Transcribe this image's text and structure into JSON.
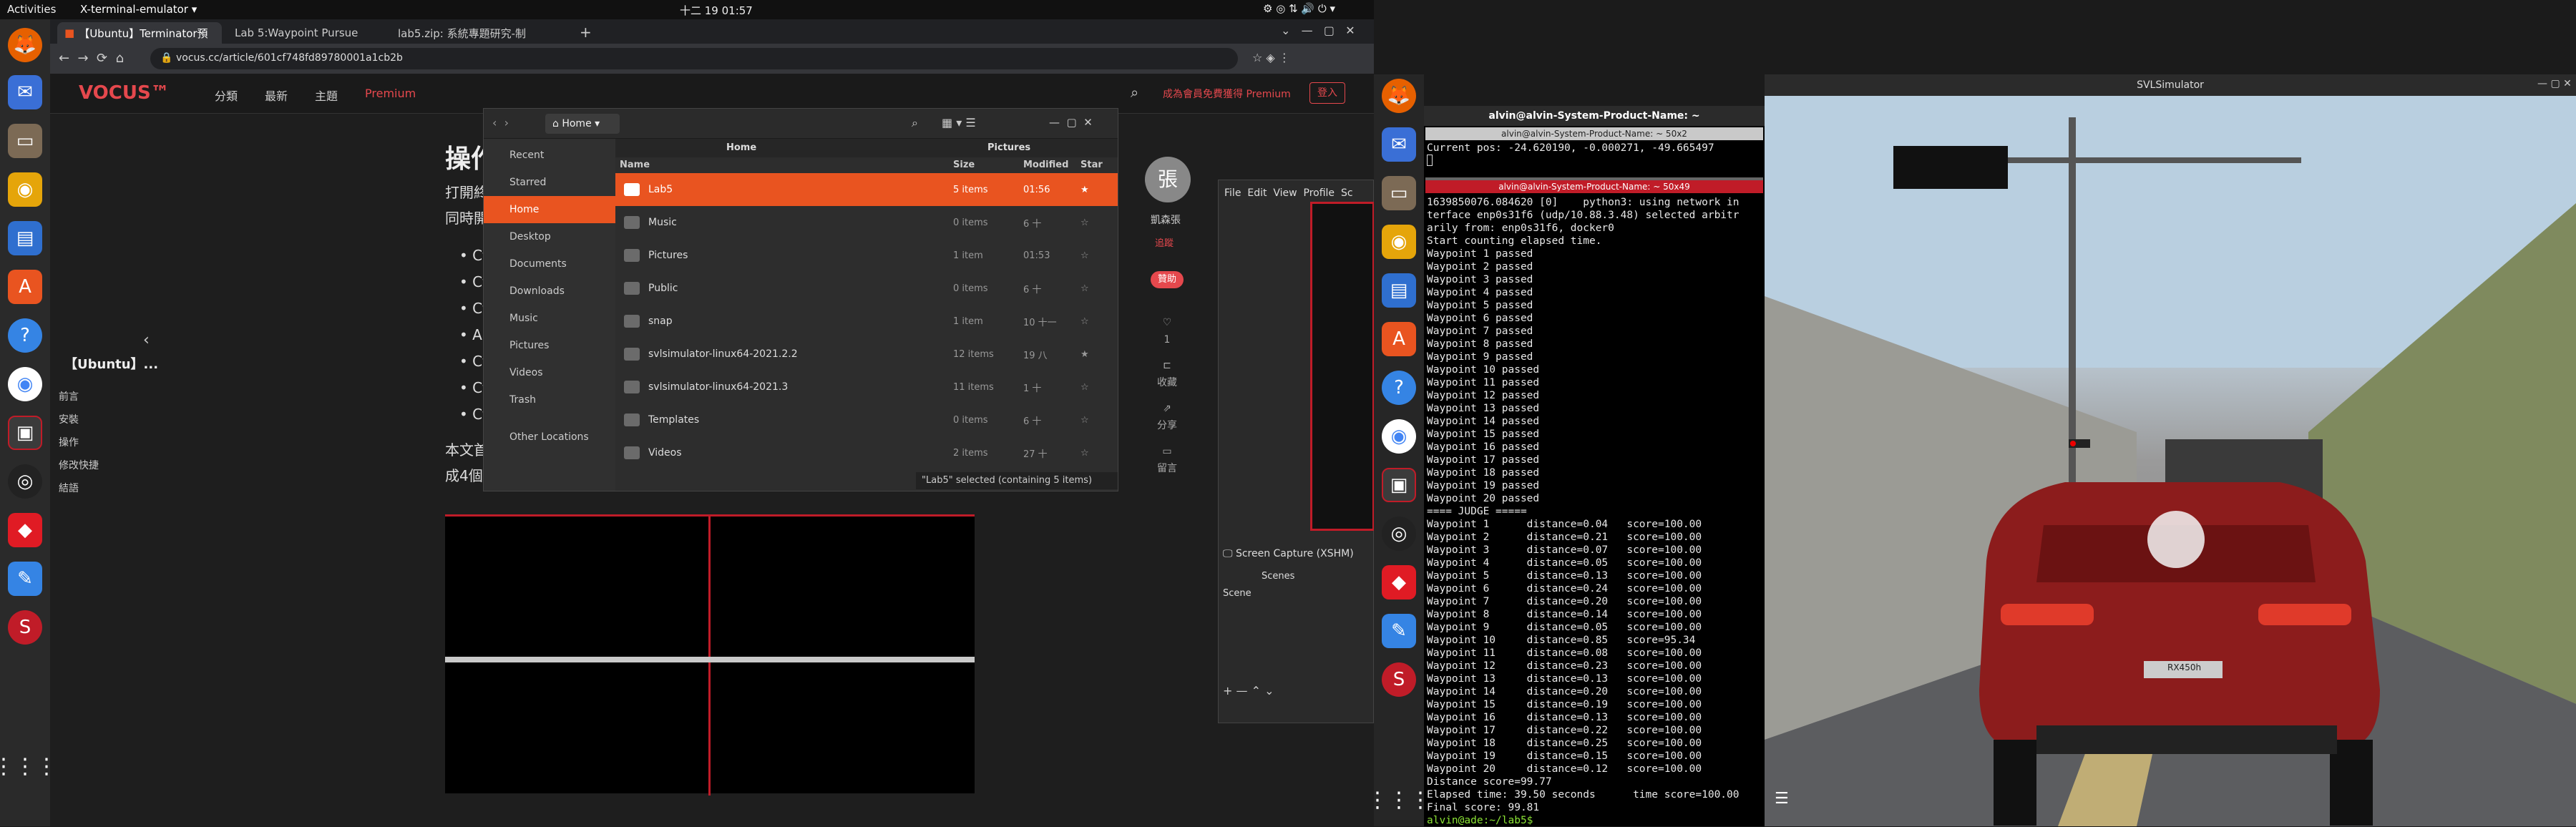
{
  "topbar": {
    "activities": "Activities",
    "app": "X-terminal-emulator ▾",
    "clock": "十二 19  01:57"
  },
  "browser": {
    "tabs": [
      "【Ubuntu】Terminator預",
      "Lab 5:Waypoint Pursue",
      "lab5.zip: 系統專題研究-制"
    ],
    "url": "vocus.cc/article/601cf748fd89780001a1cb2b",
    "site_nav": [
      "分類",
      "最新",
      "主題",
      "Premium"
    ],
    "logo": "VOCUS™",
    "promo": "成為會員免費獲得 Premium",
    "login": "登入",
    "heading": "操作",
    "para1": "打開終",
    "para2": "同時開",
    "bullets": [
      "Ct",
      "Ct",
      "Ct",
      "Alt",
      "Ct",
      "Ct",
      "Ct"
    ],
    "para3": "本文首",
    "para4": "成4個",
    "toc_title": "【Ubuntu】...",
    "toc": [
      "前言",
      "安裝",
      "操作",
      "修改快捷",
      "結語"
    ],
    "author": "凱森張",
    "author_avatar": "張",
    "follow": "追蹤",
    "sponsor": "贊助",
    "actions": [
      "1",
      "收藏",
      "分享",
      "留言"
    ]
  },
  "files": {
    "location": "Home",
    "tabs": [
      "Home",
      "Pictures"
    ],
    "sidebar": [
      "Recent",
      "Starred",
      "Home",
      "Desktop",
      "Documents",
      "Downloads",
      "Music",
      "Pictures",
      "Videos",
      "Trash",
      "Other Locations"
    ],
    "columns": [
      "Name",
      "Size",
      "Modified",
      "Star"
    ],
    "rows": [
      {
        "name": "Lab5",
        "size": "5 items",
        "mod": "01:56",
        "star": "★"
      },
      {
        "name": "Music",
        "size": "0 items",
        "mod": "6 十",
        "star": "☆"
      },
      {
        "name": "Pictures",
        "size": "1 item",
        "mod": "01:53",
        "star": "☆"
      },
      {
        "name": "Public",
        "size": "0 items",
        "mod": "6 十",
        "star": "☆"
      },
      {
        "name": "snap",
        "size": "1 item",
        "mod": "10 十一",
        "star": "☆"
      },
      {
        "name": "svlsimulator-linux64-2021.2.2",
        "size": "12 items",
        "mod": "19 八",
        "star": "★"
      },
      {
        "name": "svlsimulator-linux64-2021.3",
        "size": "11 items",
        "mod": "1 十",
        "star": "☆"
      },
      {
        "name": "Templates",
        "size": "0 items",
        "mod": "6 十",
        "star": "☆"
      },
      {
        "name": "Videos",
        "size": "2 items",
        "mod": "27 十",
        "star": "☆"
      }
    ],
    "status": "\"Lab5\" selected  (containing 5 items)"
  },
  "obs": {
    "menu": [
      "File",
      "Edit",
      "View",
      "Profile",
      "Sc"
    ],
    "source": "Screen Capture (XSHM)",
    "scenes": "Scenes",
    "scene": "Scene"
  },
  "terminal": {
    "title": "alvin@alvin-System-Product-Name: ~",
    "pane1_title": "alvin@alvin-System-Product-Name: ~ 50x2",
    "pane1_line": "Current pos: -24.620190, -0.000271, -49.665497",
    "pane2_title": "alvin@alvin-System-Product-Name: ~ 50x49",
    "lines": [
      "1639850076.084620 [0]    python3: using network in",
      "terface enp0s31f6 (udp/10.88.3.48) selected arbitr",
      "arily from: enp0s31f6, docker0",
      "Start counting elapsed time.",
      "Waypoint 1 passed",
      "Waypoint 2 passed",
      "Waypoint 3 passed",
      "Waypoint 4 passed",
      "Waypoint 5 passed",
      "Waypoint 6 passed",
      "Waypoint 7 passed",
      "Waypoint 8 passed",
      "Waypoint 9 passed",
      "Waypoint 10 passed",
      "Waypoint 11 passed",
      "Waypoint 12 passed",
      "Waypoint 13 passed",
      "Waypoint 14 passed",
      "Waypoint 15 passed",
      "Waypoint 16 passed",
      "Waypoint 17 passed",
      "Waypoint 18 passed",
      "Waypoint 19 passed",
      "Waypoint 20 passed",
      "==== JUDGE =====",
      "Waypoint 1      distance=0.04   score=100.00",
      "Waypoint 2      distance=0.21   score=100.00",
      "Waypoint 3      distance=0.07   score=100.00",
      "Waypoint 4      distance=0.05   score=100.00",
      "Waypoint 5      distance=0.13   score=100.00",
      "Waypoint 6      distance=0.24   score=100.00",
      "Waypoint 7      distance=0.20   score=100.00",
      "Waypoint 8      distance=0.14   score=100.00",
      "Waypoint 9      distance=0.05   score=100.00",
      "Waypoint 10     distance=0.85   score=95.34",
      "Waypoint 11     distance=0.08   score=100.00",
      "Waypoint 12     distance=0.23   score=100.00",
      "Waypoint 13     distance=0.13   score=100.00",
      "Waypoint 14     distance=0.20   score=100.00",
      "Waypoint 15     distance=0.19   score=100.00",
      "Waypoint 16     distance=0.13   score=100.00",
      "Waypoint 17     distance=0.22   score=100.00",
      "Waypoint 18     distance=0.25   score=100.00",
      "Waypoint 19     distance=0.15   score=100.00",
      "Waypoint 20     distance=0.12   score=100.00",
      "Distance score=99.77",
      "Elapsed time: 39.50 seconds      time score=100.00",
      "Final score: 99.81"
    ],
    "prompt": "alvin@ade:~/lab5$ "
  },
  "sim": {
    "title": "SVLSimulator",
    "plate": "RX450h"
  },
  "colors": {
    "accent": "#e95420",
    "ubuntu_orange": "#e95420",
    "term_title_red": "#c01c28"
  }
}
